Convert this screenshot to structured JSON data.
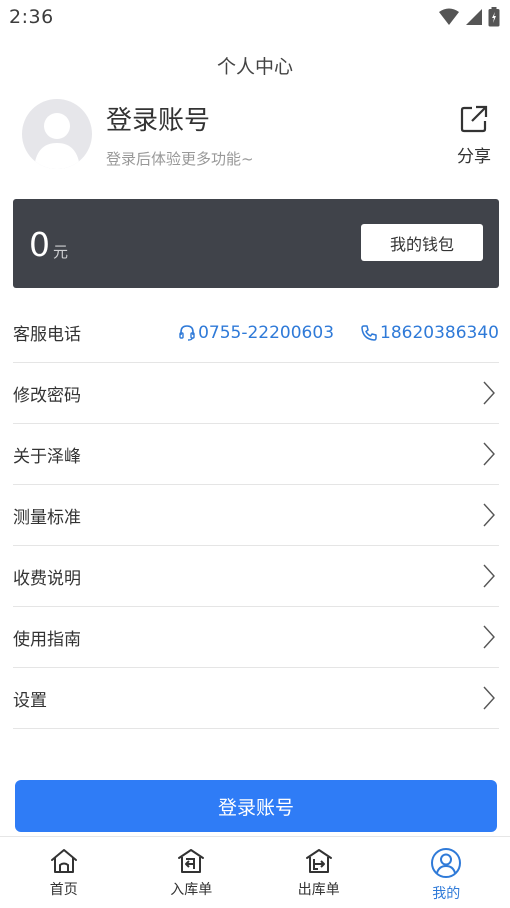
{
  "status_bar": {
    "time": "2:36"
  },
  "header": {
    "title": "个人中心"
  },
  "profile": {
    "name": "登录账号",
    "hint": "登录后体验更多功能~",
    "share_label": "分享"
  },
  "wallet": {
    "amount": "0",
    "unit": "元",
    "button_label": "我的钱包",
    "background": "#40434a"
  },
  "service": {
    "label": "客服电话",
    "phone1": "0755-22200603",
    "phone2": "18620386340",
    "link_color": "#2f7ad8"
  },
  "menu": {
    "items": [
      {
        "label": "修改密码"
      },
      {
        "label": "关于泽峰"
      },
      {
        "label": "测量标准"
      },
      {
        "label": "收费说明"
      },
      {
        "label": "使用指南"
      },
      {
        "label": "设置"
      }
    ]
  },
  "login_button": {
    "label": "登录账号",
    "color": "#2f7cf6"
  },
  "tabbar": {
    "tabs": [
      {
        "label": "首页",
        "icon": "home-icon"
      },
      {
        "label": "入库单",
        "icon": "warehouse-in-icon"
      },
      {
        "label": "出库单",
        "icon": "warehouse-out-icon"
      },
      {
        "label": "我的",
        "icon": "user-circle-icon",
        "active": true
      }
    ],
    "active_color": "#2f7ad8"
  }
}
